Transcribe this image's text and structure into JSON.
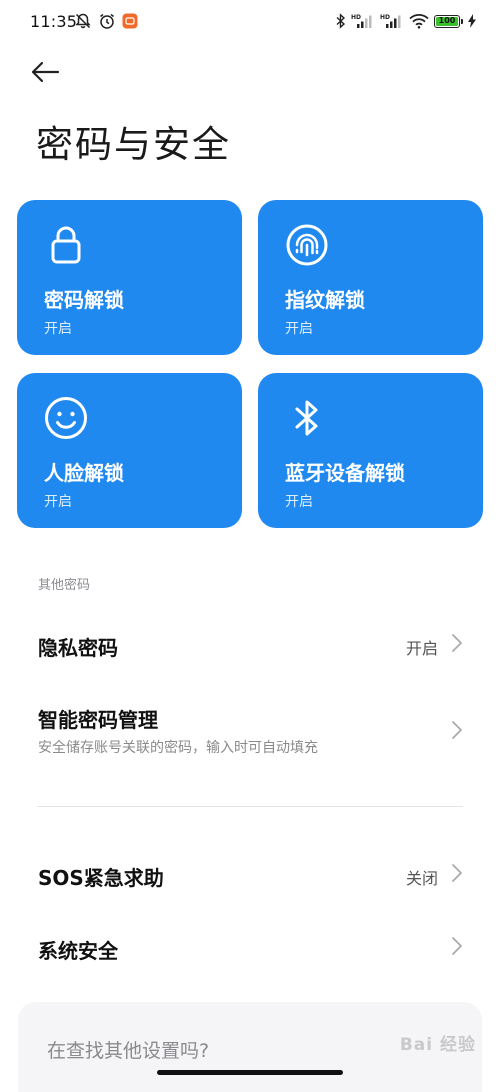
{
  "status_bar": {
    "time": "11:35",
    "battery": "100",
    "left_icons": [
      "bell-off-icon",
      "alarm-clock-icon",
      "mi-app-icon"
    ],
    "right_icons": [
      "bluetooth-icon",
      "hd-signal-icon",
      "hd-signal-icon",
      "wifi-icon",
      "battery-icon",
      "charging-bolt-icon"
    ]
  },
  "page": {
    "title": "密码与安全"
  },
  "tiles": [
    {
      "title": "密码解锁",
      "status": "开启",
      "icon": "lock-icon"
    },
    {
      "title": "指纹解锁",
      "status": "开启",
      "icon": "fingerprint-icon"
    },
    {
      "title": "人脸解锁",
      "status": "开启",
      "icon": "smiley-face-icon"
    },
    {
      "title": "蓝牙设备解锁",
      "status": "开启",
      "icon": "bluetooth-icon"
    }
  ],
  "other_passwords": {
    "header": "其他密码",
    "privacy": {
      "title": "隐私密码",
      "value": "开启"
    },
    "smart": {
      "title": "智能密码管理",
      "subtitle": "安全储存账号关联的密码，输入时可自动填充"
    }
  },
  "more": {
    "sos": {
      "title": "SOS紧急求助",
      "value": "关闭"
    },
    "system": {
      "title": "系统安全"
    }
  },
  "search_card": {
    "text": "在查找其他设置吗?"
  },
  "watermark": "Bai 经验",
  "colors": {
    "tile_blue": "#2089f0",
    "battery_green": "#3bbf2c"
  }
}
